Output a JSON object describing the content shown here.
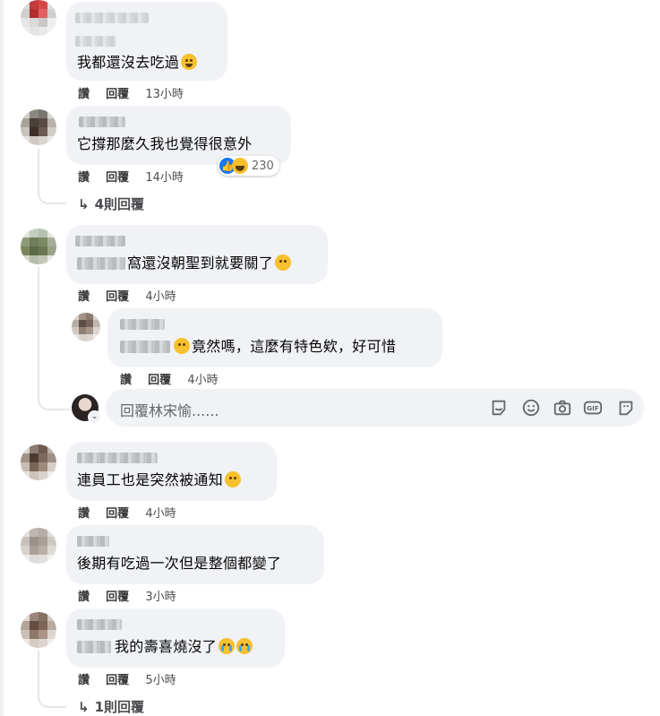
{
  "comments": [
    {
      "text": "我都還沒去吃過",
      "emoji": "grinning-sweat-emoji",
      "actions": {
        "like": "讚",
        "reply": "回覆",
        "time": "13小時"
      }
    },
    {
      "text": "它撐那麼久我也覺得很意外",
      "actions": {
        "like": "讚",
        "reply": "回覆",
        "time": "14小時"
      },
      "reactions": {
        "icons": [
          "like-icon",
          "haha-icon"
        ],
        "count": "230"
      },
      "view_replies": "4則回覆"
    },
    {
      "text": "窩還沒朝聖到就要關了",
      "emoji": "sad-emoji",
      "actions": {
        "like": "讚",
        "reply": "回覆",
        "time": "4小時"
      },
      "reply": {
        "text": "竟然嗎，這麼有特色欸，好可惜",
        "emoji": "flushed-emoji",
        "actions": {
          "like": "讚",
          "reply": "回覆",
          "time": "4小時"
        }
      }
    },
    {
      "text": "連員工也是突然被通知",
      "emoji": "sad-emoji",
      "actions": {
        "like": "讚",
        "reply": "回覆",
        "time": "4小時"
      }
    },
    {
      "text": "後期有吃過一次但是整個都變了",
      "actions": {
        "like": "讚",
        "reply": "回覆",
        "time": "3小時"
      }
    },
    {
      "text": "我的壽喜燒沒了",
      "emoji": "crying-emoji",
      "actions": {
        "like": "讚",
        "reply": "回覆",
        "time": "5小時"
      },
      "view_replies": "1則回覆"
    }
  ],
  "reply_box": {
    "placeholder": "回覆林宋愉......",
    "icons": [
      "sticker-icon",
      "smiley-icon",
      "camera-icon",
      "gif-icon",
      "sticker-alt-icon"
    ]
  }
}
